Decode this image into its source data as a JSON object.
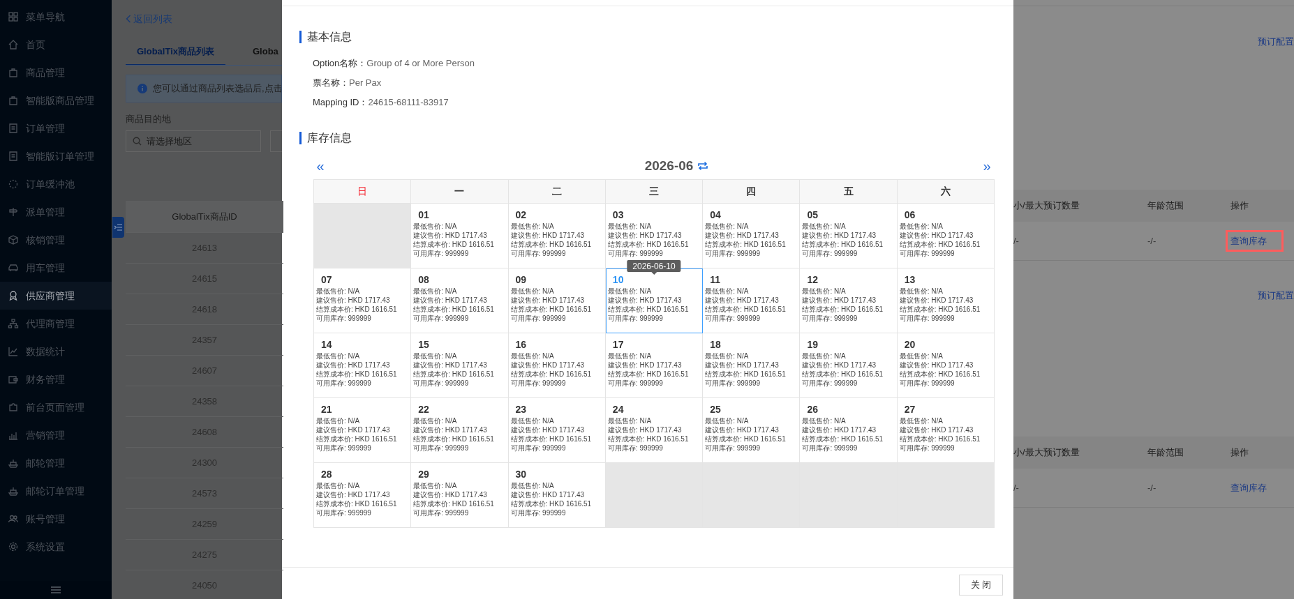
{
  "sidebar": {
    "items": [
      {
        "label": "菜单导航",
        "selected": false
      },
      {
        "label": "首页",
        "selected": false
      },
      {
        "label": "商品管理",
        "selected": false
      },
      {
        "label": "智能版商品管理",
        "selected": false
      },
      {
        "label": "订单管理",
        "selected": false
      },
      {
        "label": "智能版订单管理",
        "selected": false
      },
      {
        "label": "订单缓冲池",
        "selected": false
      },
      {
        "label": "派单管理",
        "selected": false
      },
      {
        "label": "核销管理",
        "selected": false
      },
      {
        "label": "用车管理",
        "selected": false
      },
      {
        "label": "供应商管理",
        "selected": true
      },
      {
        "label": "代理商管理",
        "selected": false
      },
      {
        "label": "数据统计",
        "selected": false
      },
      {
        "label": "财务管理",
        "selected": false
      },
      {
        "label": "前台页面管理",
        "selected": false
      },
      {
        "label": "营销管理",
        "selected": false
      },
      {
        "label": "邮轮管理",
        "selected": false
      },
      {
        "label": "邮轮订单管理",
        "selected": false
      },
      {
        "label": "账号管理",
        "selected": false
      },
      {
        "label": "系统设置",
        "selected": false
      }
    ]
  },
  "page": {
    "back_link": "返回列表",
    "tabs": [
      {
        "label": "GlobalTix商品列表",
        "selected": true
      },
      {
        "label": "Globa",
        "selected": false
      }
    ],
    "alert": "您可以通过商品列表选品后,点击",
    "destination": {
      "label": "商品目的地",
      "placeholder": "请选择地区"
    },
    "table": {
      "columns": [
        "GlobalTix商品ID"
      ],
      "rows": [
        "24613",
        "24615",
        "24618",
        "24357",
        "24607",
        "24358",
        "24608",
        "24300",
        "24573",
        "24259",
        "24275",
        "24050"
      ]
    },
    "options": [
      {
        "config_link": "预订配置",
        "columns": [
          "小/最大预订数量",
          "年龄范围",
          "操作"
        ],
        "row": {
          "quantity": "/-",
          "age_range": "-/-",
          "action": "查询库存",
          "highlighted": true
        }
      },
      {
        "config_link": "预订配置",
        "columns": [
          "小/最大预订数量",
          "年龄范围",
          "操作"
        ],
        "row": {
          "quantity": "/-",
          "age_range": "-/-",
          "action": "查询库存",
          "highlighted": false
        }
      }
    ]
  },
  "modal": {
    "sections": [
      {
        "title": "基本信息"
      },
      {
        "title": "库存信息"
      }
    ],
    "info": [
      {
        "label": "Option名称：",
        "value": "Group of 4 or More Person"
      },
      {
        "label": "票名称：",
        "value": "Per Pax"
      },
      {
        "label": "Mapping ID：",
        "value": "24615-68111-83917"
      }
    ],
    "calendar": {
      "prev": "«",
      "title": "2026-06",
      "next": "»",
      "tooltip": "2026-06-10",
      "weekdays": [
        {
          "label": "日",
          "highlighted": true
        },
        {
          "label": "一",
          "highlighted": false
        },
        {
          "label": "二",
          "highlighted": false
        },
        {
          "label": "三",
          "highlighted": false
        },
        {
          "label": "四",
          "highlighted": false
        },
        {
          "label": "五",
          "highlighted": false
        },
        {
          "label": "六",
          "highlighted": false
        }
      ],
      "cells": [
        {
          "kind": "blank"
        },
        {
          "kind": "day",
          "day": "01",
          "selected": false,
          "lines": [
            "最低售价: N/A",
            "建议售价: HKD 1717.43",
            "结算成本价: HKD 1616.51",
            "可用库存: 999999"
          ]
        },
        {
          "kind": "day",
          "day": "02",
          "selected": false,
          "lines": [
            "最低售价: N/A",
            "建议售价: HKD 1717.43",
            "结算成本价: HKD 1616.51",
            "可用库存: 999999"
          ]
        },
        {
          "kind": "day",
          "day": "03",
          "selected": false,
          "lines": [
            "最低售价: N/A",
            "建议售价: HKD 1717.43",
            "结算成本价: HKD 1616.51",
            "可用库存: 999999"
          ]
        },
        {
          "kind": "day",
          "day": "04",
          "selected": false,
          "lines": [
            "最低售价: N/A",
            "建议售价: HKD 1717.43",
            "结算成本价: HKD 1616.51",
            "可用库存: 999999"
          ]
        },
        {
          "kind": "day",
          "day": "05",
          "selected": false,
          "lines": [
            "最低售价: N/A",
            "建议售价: HKD 1717.43",
            "结算成本价: HKD 1616.51",
            "可用库存: 999999"
          ]
        },
        {
          "kind": "day",
          "day": "06",
          "selected": false,
          "lines": [
            "最低售价: N/A",
            "建议售价: HKD 1717.43",
            "结算成本价: HKD 1616.51",
            "可用库存: 999999"
          ]
        },
        {
          "kind": "day",
          "day": "07",
          "selected": false,
          "lines": [
            "最低售价: N/A",
            "建议售价: HKD 1717.43",
            "结算成本价: HKD 1616.51",
            "可用库存: 999999"
          ]
        },
        {
          "kind": "day",
          "day": "08",
          "selected": false,
          "lines": [
            "最低售价: N/A",
            "建议售价: HKD 1717.43",
            "结算成本价: HKD 1616.51",
            "可用库存: 999999"
          ]
        },
        {
          "kind": "day",
          "day": "09",
          "selected": false,
          "lines": [
            "最低售价: N/A",
            "建议售价: HKD 1717.43",
            "结算成本价: HKD 1616.51",
            "可用库存: 999999"
          ]
        },
        {
          "kind": "day",
          "day": "10",
          "selected": true,
          "lines": [
            "最低售价: N/A",
            "建议售价: HKD 1717.43",
            "结算成本价: HKD 1616.51",
            "可用库存: 999999"
          ]
        },
        {
          "kind": "day",
          "day": "11",
          "selected": false,
          "lines": [
            "最低售价: N/A",
            "建议售价: HKD 1717.43",
            "结算成本价: HKD 1616.51",
            "可用库存: 999999"
          ]
        },
        {
          "kind": "day",
          "day": "12",
          "selected": false,
          "lines": [
            "最低售价: N/A",
            "建议售价: HKD 1717.43",
            "结算成本价: HKD 1616.51",
            "可用库存: 999999"
          ]
        },
        {
          "kind": "day",
          "day": "13",
          "selected": false,
          "lines": [
            "最低售价: N/A",
            "建议售价: HKD 1717.43",
            "结算成本价: HKD 1616.51",
            "可用库存: 999999"
          ]
        },
        {
          "kind": "day",
          "day": "14",
          "selected": false,
          "lines": [
            "最低售价: N/A",
            "建议售价: HKD 1717.43",
            "结算成本价: HKD 1616.51",
            "可用库存: 999999"
          ]
        },
        {
          "kind": "day",
          "day": "15",
          "selected": false,
          "lines": [
            "最低售价: N/A",
            "建议售价: HKD 1717.43",
            "结算成本价: HKD 1616.51",
            "可用库存: 999999"
          ]
        },
        {
          "kind": "day",
          "day": "16",
          "selected": false,
          "lines": [
            "最低售价: N/A",
            "建议售价: HKD 1717.43",
            "结算成本价: HKD 1616.51",
            "可用库存: 999999"
          ]
        },
        {
          "kind": "day",
          "day": "17",
          "selected": false,
          "lines": [
            "最低售价: N/A",
            "建议售价: HKD 1717.43",
            "结算成本价: HKD 1616.51",
            "可用库存: 999999"
          ]
        },
        {
          "kind": "day",
          "day": "18",
          "selected": false,
          "lines": [
            "最低售价: N/A",
            "建议售价: HKD 1717.43",
            "结算成本价: HKD 1616.51",
            "可用库存: 999999"
          ]
        },
        {
          "kind": "day",
          "day": "19",
          "selected": false,
          "lines": [
            "最低售价: N/A",
            "建议售价: HKD 1717.43",
            "结算成本价: HKD 1616.51",
            "可用库存: 999999"
          ]
        },
        {
          "kind": "day",
          "day": "20",
          "selected": false,
          "lines": [
            "最低售价: N/A",
            "建议售价: HKD 1717.43",
            "结算成本价: HKD 1616.51",
            "可用库存: 999999"
          ]
        },
        {
          "kind": "day",
          "day": "21",
          "selected": false,
          "lines": [
            "最低售价: N/A",
            "建议售价: HKD 1717.43",
            "结算成本价: HKD 1616.51",
            "可用库存: 999999"
          ]
        },
        {
          "kind": "day",
          "day": "22",
          "selected": false,
          "lines": [
            "最低售价: N/A",
            "建议售价: HKD 1717.43",
            "结算成本价: HKD 1616.51",
            "可用库存: 999999"
          ]
        },
        {
          "kind": "day",
          "day": "23",
          "selected": false,
          "lines": [
            "最低售价: N/A",
            "建议售价: HKD 1717.43",
            "结算成本价: HKD 1616.51",
            "可用库存: 999999"
          ]
        },
        {
          "kind": "day",
          "day": "24",
          "selected": false,
          "lines": [
            "最低售价: N/A",
            "建议售价: HKD 1717.43",
            "结算成本价: HKD 1616.51",
            "可用库存: 999999"
          ]
        },
        {
          "kind": "day",
          "day": "25",
          "selected": false,
          "lines": [
            "最低售价: N/A",
            "建议售价: HKD 1717.43",
            "结算成本价: HKD 1616.51",
            "可用库存: 999999"
          ]
        },
        {
          "kind": "day",
          "day": "26",
          "selected": false,
          "lines": [
            "最低售价: N/A",
            "建议售价: HKD 1717.43",
            "结算成本价: HKD 1616.51",
            "可用库存: 999999"
          ]
        },
        {
          "kind": "day",
          "day": "27",
          "selected": false,
          "lines": [
            "最低售价: N/A",
            "建议售价: HKD 1717.43",
            "结算成本价: HKD 1616.51",
            "可用库存: 999999"
          ]
        },
        {
          "kind": "day",
          "day": "28",
          "selected": false,
          "lines": [
            "最低售价: N/A",
            "建议售价: HKD 1717.43",
            "结算成本价: HKD 1616.51",
            "可用库存: 999999"
          ]
        },
        {
          "kind": "day",
          "day": "29",
          "selected": false,
          "lines": [
            "最低售价: N/A",
            "建议售价: HKD 1717.43",
            "结算成本价: HKD 1616.51",
            "可用库存: 999999"
          ]
        },
        {
          "kind": "day",
          "day": "30",
          "selected": false,
          "lines": [
            "最低售价: N/A",
            "建议售价: HKD 1717.43",
            "结算成本价: HKD 1616.51",
            "可用库存: 999999"
          ]
        },
        {
          "kind": "blank"
        },
        {
          "kind": "blank"
        },
        {
          "kind": "blank"
        },
        {
          "kind": "blank"
        }
      ]
    },
    "close_button": "关 闭"
  }
}
